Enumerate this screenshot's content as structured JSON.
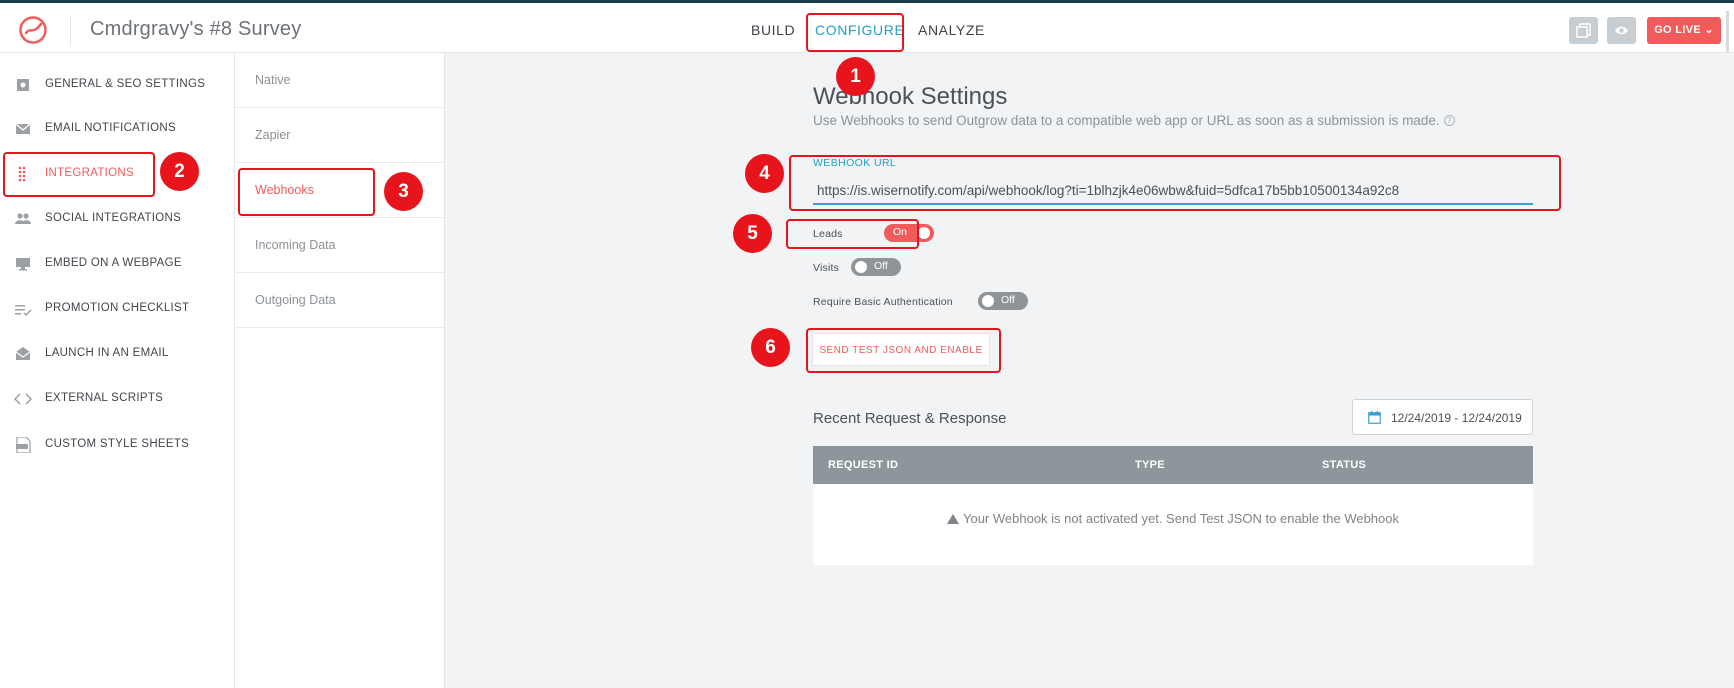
{
  "header": {
    "title": "Cmdrgravy's #8 Survey",
    "nav": [
      "BUILD",
      "CONFIGURE",
      "ANALYZE"
    ],
    "go_live": "GO LIVE ⌄"
  },
  "sidebar": {
    "items": [
      {
        "label": "GENERAL & SEO SETTINGS",
        "icon": "settings-icon"
      },
      {
        "label": "EMAIL NOTIFICATIONS",
        "icon": "envelope-icon"
      },
      {
        "label": "INTEGRATIONS",
        "icon": "grid-dots-icon",
        "active": true
      },
      {
        "label": "SOCIAL INTEGRATIONS",
        "icon": "people-icon"
      },
      {
        "label": "EMBED ON A WEBPAGE",
        "icon": "monitor-icon"
      },
      {
        "label": "PROMOTION CHECKLIST",
        "icon": "checklist-icon"
      },
      {
        "label": "LAUNCH IN AN EMAIL",
        "icon": "open-envelope-icon"
      },
      {
        "label": "EXTERNAL SCRIPTS",
        "icon": "code-icon"
      },
      {
        "label": "CUSTOM STYLE SHEETS",
        "icon": "css-file-icon"
      }
    ]
  },
  "subnav": {
    "items": [
      "Native",
      "Zapier",
      "Webhooks",
      "Incoming Data",
      "Outgoing Data"
    ],
    "active": "Webhooks"
  },
  "webhook": {
    "title": "Webhook Settings",
    "description": "Use Webhooks to send Outgrow data to a compatible web app or URL as soon as a submission is made.",
    "help": "?",
    "url_label": "WEBHOOK URL",
    "url_value": "https://is.wisernotify.com/api/webhook/log?ti=1blhzjk4e06wbw&fuid=5dfca17b5bb10500134a92c8",
    "toggles": {
      "leads": {
        "label": "Leads",
        "state": "On"
      },
      "visits": {
        "label": "Visits",
        "state": "Off"
      },
      "auth": {
        "label": "Require Basic Authentication",
        "state": "Off"
      }
    },
    "send_button": "SEND TEST JSON AND ENABLE"
  },
  "recent": {
    "title": "Recent Request & Response",
    "date_range": "12/24/2019 - 12/24/2019",
    "columns": [
      "REQUEST ID",
      "TYPE",
      "STATUS"
    ],
    "empty_message": "Your Webhook is not activated yet. Send Test JSON to enable the Webhook"
  },
  "annotations": [
    "1",
    "2",
    "3",
    "4",
    "5",
    "6"
  ],
  "colors": {
    "accent_red": "#f15b5b",
    "accent_blue": "#1ea2c6",
    "annotation_red": "#e8141c",
    "table_header": "#8d979b"
  }
}
